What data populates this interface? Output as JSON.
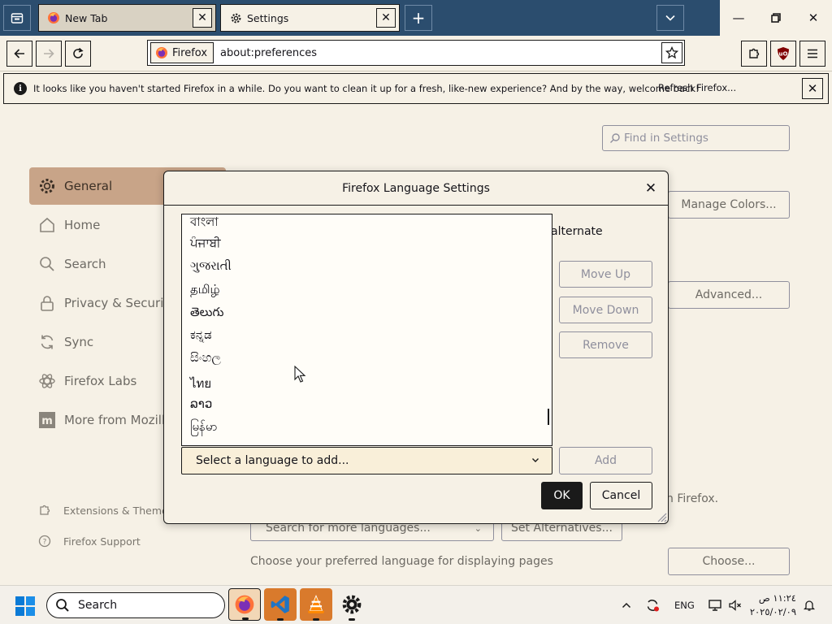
{
  "browser": {
    "tabs": [
      {
        "label": "New Tab",
        "icon": "firefox-icon"
      },
      {
        "label": "Settings",
        "icon": "gear-icon"
      }
    ],
    "identity_label": "Firefox",
    "url": "about:preferences"
  },
  "notification": {
    "message": "It looks like you haven't started Firefox in a while. Do you want to clean it up for a fresh, like-new experience? And by the way, welcome back!",
    "action_label": "Refresh Firefox..."
  },
  "prefs": {
    "search_placeholder": "Find in Settings",
    "categories": [
      {
        "label": "General",
        "icon": "gear-icon"
      },
      {
        "label": "Home",
        "icon": "home-icon"
      },
      {
        "label": "Search",
        "icon": "search-icon"
      },
      {
        "label": "Privacy & Security",
        "icon": "lock-icon"
      },
      {
        "label": "Sync",
        "icon": "sync-icon"
      },
      {
        "label": "Firefox Labs",
        "icon": "atom-icon"
      },
      {
        "label": "More from Mozilla",
        "icon": "mozilla-icon"
      }
    ],
    "footer_links": [
      {
        "label": "Extensions & Themes",
        "icon": "puzzle-icon"
      },
      {
        "label": "Firefox Support",
        "icon": "help-icon"
      }
    ],
    "manage_colors_label": "Manage Colors...",
    "advanced_label": "Advanced...",
    "in_firefox_text": "n Firefox.",
    "search_languages_label": "Search for more languages...",
    "set_alternatives_label": "Set Alternatives...",
    "choose_pages_text": "Choose your preferred language for displaying pages",
    "choose_label": "Choose..."
  },
  "dialog": {
    "title": "Firefox Language Settings",
    "languages": [
      "বাংলা",
      "ਪੰਜਾਬੀ",
      "ગુજરાતી",
      "தமிழ்",
      "తెలుగు",
      "ಕನ್ನಡ",
      "සිංහල",
      "ไทย",
      "ລາວ",
      "မြန်မာ"
    ],
    "alternate_text": "alternate",
    "move_up_label": "Move Up",
    "move_down_label": "Move Down",
    "remove_label": "Remove",
    "select_placeholder": "Select a language to add...",
    "add_label": "Add",
    "ok_label": "OK",
    "cancel_label": "Cancel"
  },
  "taskbar": {
    "search_label": "Search",
    "language": "ENG",
    "time": "١١:٢٤ ص",
    "date": "٢٠٢٥/٠٢/٠٩"
  },
  "colors": {
    "tabstrip": "#2b4d6e",
    "page_bg": "#f6f1e6",
    "selected_category": "#c8a488"
  }
}
